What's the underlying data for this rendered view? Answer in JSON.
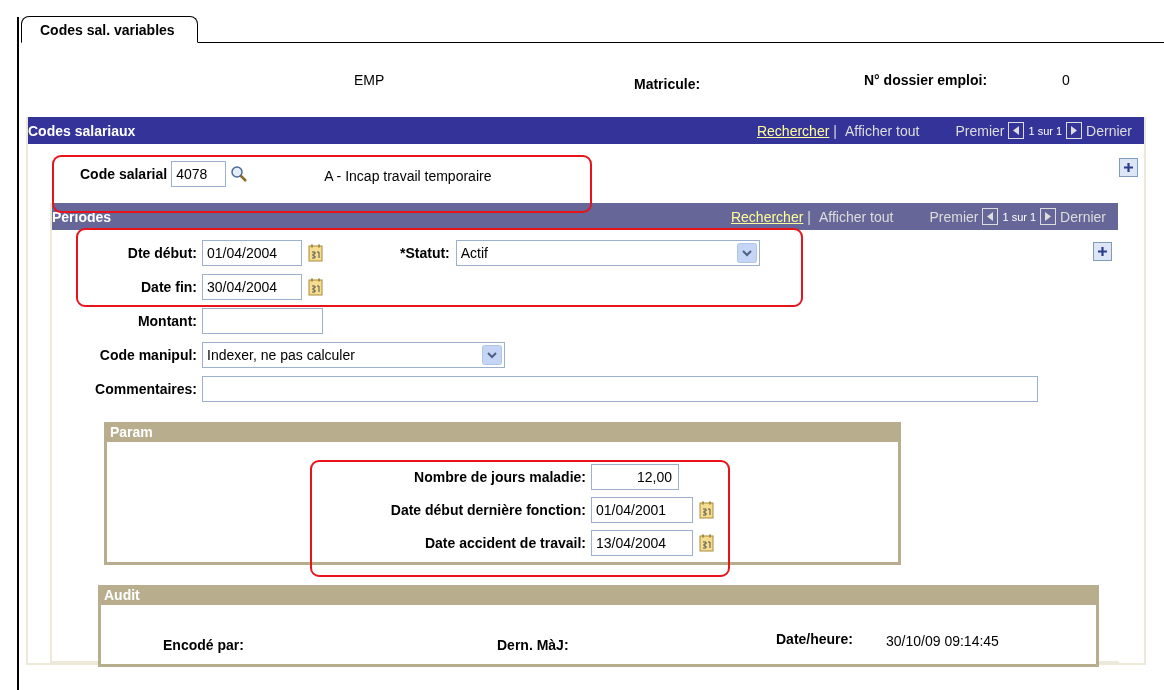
{
  "tab": {
    "label": "Codes sal. variables",
    "selected": true
  },
  "header": {
    "employee": "EMP",
    "matricule_label": "Matricule:",
    "dossier_label": "N° dossier emploi:",
    "dossier_value": "0"
  },
  "codes_section": {
    "title": "Codes salariaux",
    "nav": {
      "search": "Rechercher",
      "separator": "|",
      "show_all": "Afficher tout",
      "first": "Premier",
      "position": "1 sur 1",
      "last": "Dernier"
    }
  },
  "code_salarial": {
    "label": "Code salarial",
    "value": "4078",
    "description": "A - Incap travail temporaire"
  },
  "periodes_section": {
    "title": "Périodes",
    "nav": {
      "search": "Rechercher",
      "separator": "|",
      "show_all": "Afficher tout",
      "first": "Premier",
      "position": "1 sur 1",
      "last": "Dernier"
    }
  },
  "period_fields": {
    "start": {
      "label": "Dte début:",
      "value": "01/04/2004"
    },
    "end": {
      "label": "Date fin:",
      "value": "30/04/2004"
    },
    "statut": {
      "label": "*Statut:",
      "value": "Actif"
    },
    "montant": {
      "label": "Montant:"
    },
    "code_manipul": {
      "label": "Code manipul:",
      "value": "Indexer, ne pas calculer"
    },
    "commentaires": {
      "label": "Commentaires:"
    }
  },
  "param": {
    "title": "Param",
    "fields": [
      {
        "kind": "number",
        "label": "Nombre de jours maladie:",
        "value": "12,00"
      },
      {
        "kind": "date",
        "label": "Date début dernière fonction:",
        "value": "01/04/2001"
      },
      {
        "kind": "date",
        "label": "Date accident de travail:",
        "value": "13/04/2004"
      }
    ]
  },
  "audit": {
    "title": "Audit",
    "encoded_label": "Encodé par:",
    "updated_label": "Dern. MàJ:",
    "datetime_label": "Date/heure:",
    "datetime_value": "30/10/09 09:14:45"
  }
}
